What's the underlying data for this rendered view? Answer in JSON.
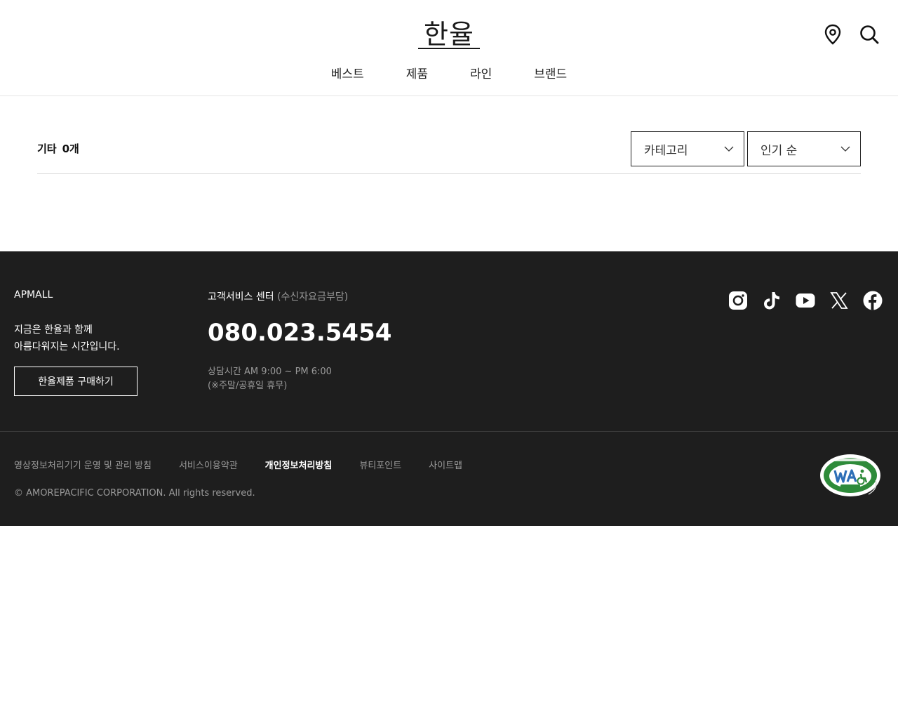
{
  "header": {
    "logo": "한율",
    "nav": [
      "베스트",
      "제품",
      "라인",
      "브랜드"
    ],
    "icons": [
      "location-icon",
      "search-icon"
    ]
  },
  "content": {
    "category_title": "기타",
    "count": "0개",
    "category_select": "카테고리",
    "sort_select": "인기 순"
  },
  "footer": {
    "brand": "APMALL",
    "slogan_line1": "지금은 한율과 함께",
    "slogan_line2": "아름다워지는 시간입니다.",
    "buy_button": "한율제품 구매하기",
    "cs_title": "고객서비스 센터",
    "cs_sub": "(수신자요금부담)",
    "phone": "080.023.5454",
    "hours_line1": "상담시간 AM 9:00 ~ PM 6:00",
    "hours_line2": "(※주말/공휴일 휴무)",
    "links": [
      "영상정보처리기기 운영 및 관리 방침",
      "서비스이용약관",
      "개인정보처리방침",
      "뷰티포인트",
      "사이트맵"
    ],
    "copyright": "© AMOREPACIFIC CORPORATION. All rights reserved.",
    "sns": [
      "instagram-icon",
      "tiktok-icon",
      "youtube-icon",
      "x-icon",
      "facebook-icon"
    ]
  }
}
